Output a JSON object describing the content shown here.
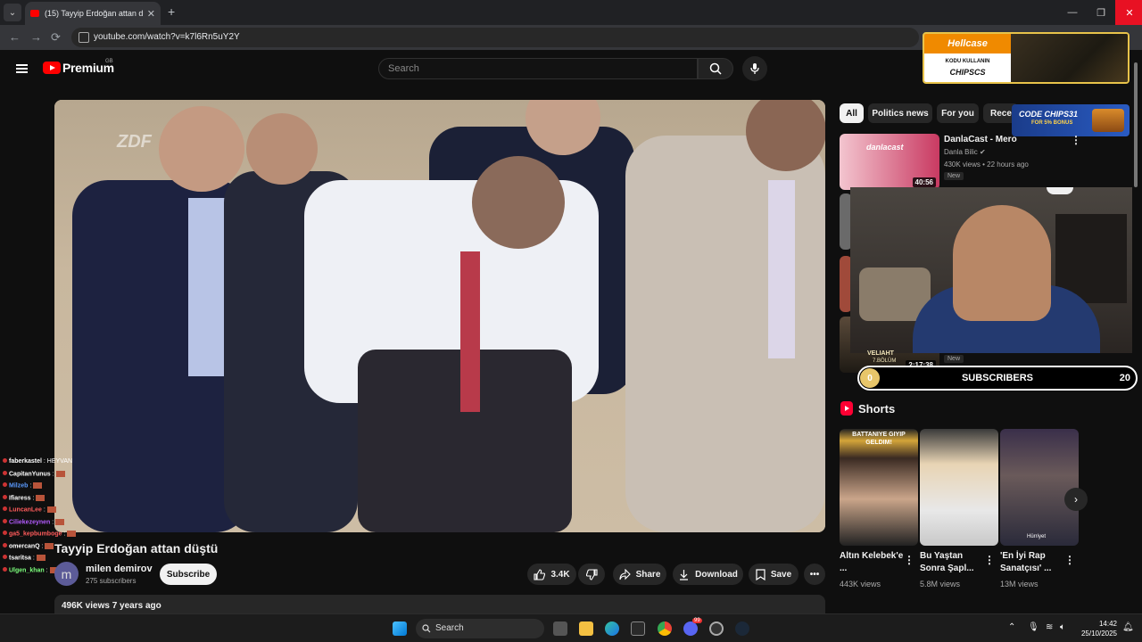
{
  "browser": {
    "tab_title": "(15) Tayyip Erdoğan attan düştü",
    "url": "youtube.com/watch?v=k7l6Rn5uY2Y",
    "new_tab": "+",
    "tab_close": "✕",
    "window_min": "—",
    "window_restore": "❐",
    "window_close": "✕"
  },
  "header": {
    "brand": "Premium",
    "region": "GB",
    "search_placeholder": "Search"
  },
  "ad_hellcase": {
    "brand": "Hellcase",
    "line1": "KODU KULLANIN",
    "line2": "CHIPSCS"
  },
  "ad_lootbox": {
    "code": "CODE CHIPS31",
    "bonus": "FOR 5% BONUS"
  },
  "video": {
    "watermark": "ZDF",
    "title": "Tayyip Erdoğan attan düştü",
    "channel": "milen demirov",
    "avatar_letter": "m",
    "subscribers": "275 subscribers",
    "subscribe_label": "Subscribe",
    "likes": "3.4K",
    "share_label": "Share",
    "download_label": "Download",
    "save_label": "Save",
    "description_meta": "496K views  7 years ago"
  },
  "chat": [
    {
      "user": "faberkastel",
      "msg": ": HEYVAN",
      "color": "#ffffff"
    },
    {
      "user": "CapitanYunus",
      "msg": ":",
      "color": "#ffffff"
    },
    {
      "user": "Milzeb",
      "msg": ":",
      "color": "#5b9bff"
    },
    {
      "user": "Ifiaress",
      "msg": ":",
      "color": "#ffffff"
    },
    {
      "user": "LuncanLee",
      "msg": ":",
      "color": "#ff5b5b"
    },
    {
      "user": "Ciliekezeynen",
      "msg": ":",
      "color": "#b35bff"
    },
    {
      "user": "ga5_kepbumboge",
      "msg": ":",
      "color": "#ff5b5b"
    },
    {
      "user": "omercanQ",
      "msg": ":",
      "color": "#ffffff"
    },
    {
      "user": "tsaritsa",
      "msg": ":",
      "color": "#ffffff"
    },
    {
      "user": "Ulgen_khan",
      "msg": ":",
      "color": "#7cff7c"
    }
  ],
  "chips": [
    "All",
    "Politics news",
    "For you",
    "Recen"
  ],
  "recommended": {
    "title": "DanlaCast - Mero",
    "channel": "Danla Bilic",
    "meta": "430K views • 22 hours ago",
    "duration": "40:56",
    "badge": "New",
    "thumb_text": "danlacast",
    "second_duration": "2:17:38",
    "second_badge": "New"
  },
  "overlay": {
    "veliaht": "VELIAHT",
    "veliaht_sub": "7.BÖLÜM",
    "sub_count": "0",
    "sub_label": "SUBSCRIBERS",
    "sub_goal": "20"
  },
  "shorts": {
    "heading": "Shorts",
    "items": [
      {
        "title": "Altın Kelebek'e ...",
        "views": "443K views",
        "overlay": "BATTANIYE GIYIP GELDIM!"
      },
      {
        "title": "Bu Yaştan Sonra Şapl...",
        "views": "5.8M views",
        "overlay": ""
      },
      {
        "title": "'En İyi Rap Sanatçısı' ...",
        "views": "13M views",
        "overlay": "Hürriyet"
      }
    ]
  },
  "taskbar": {
    "search": "Search",
    "time": "14:42",
    "date": "25/10/2025",
    "discord_badge": "99"
  }
}
